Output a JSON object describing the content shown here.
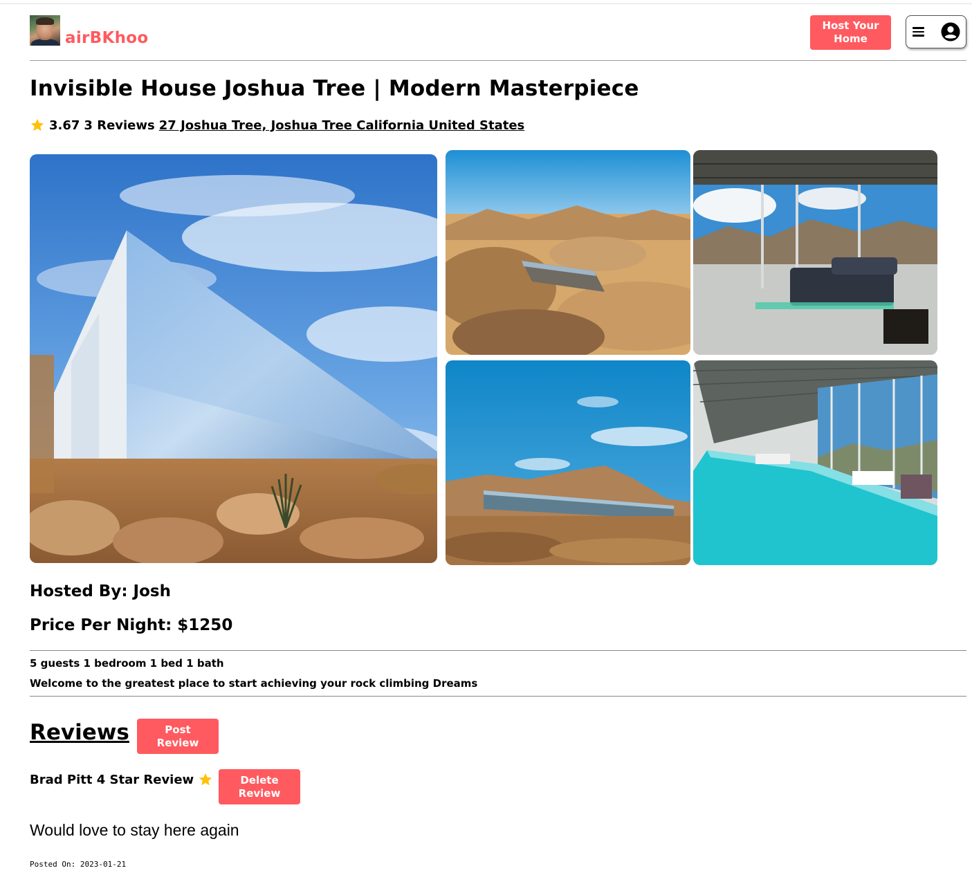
{
  "header": {
    "brand": "airBKhoo",
    "host_button": "Host Your Home",
    "menu_icon": "hamburger-icon",
    "user_icon": "user-circle-icon"
  },
  "listing": {
    "title": "Invisible House Joshua Tree | Modern Masterpiece",
    "rating": "3.67",
    "reviews_count": "3 Reviews",
    "address": "27 Joshua Tree, Joshua Tree California United States",
    "hosted_by": "Hosted By: Josh",
    "price": "Price Per Night: $1250",
    "amenities": "5 guests 1 bedroom 1 bed 1 bath",
    "description": "Welcome to the greatest place to start achieving your rock climbing Dreams"
  },
  "reviews": {
    "heading": "Reviews",
    "post_button": "Post Review",
    "items": [
      {
        "title": "Brad Pitt 4 Star Review",
        "delete_button": "Delete Review",
        "body": "Would love to stay here again",
        "posted_on": "Posted On: 2023-01-21"
      }
    ]
  },
  "colors": {
    "accent": "#ff5a5f",
    "star": "#ffc107"
  }
}
